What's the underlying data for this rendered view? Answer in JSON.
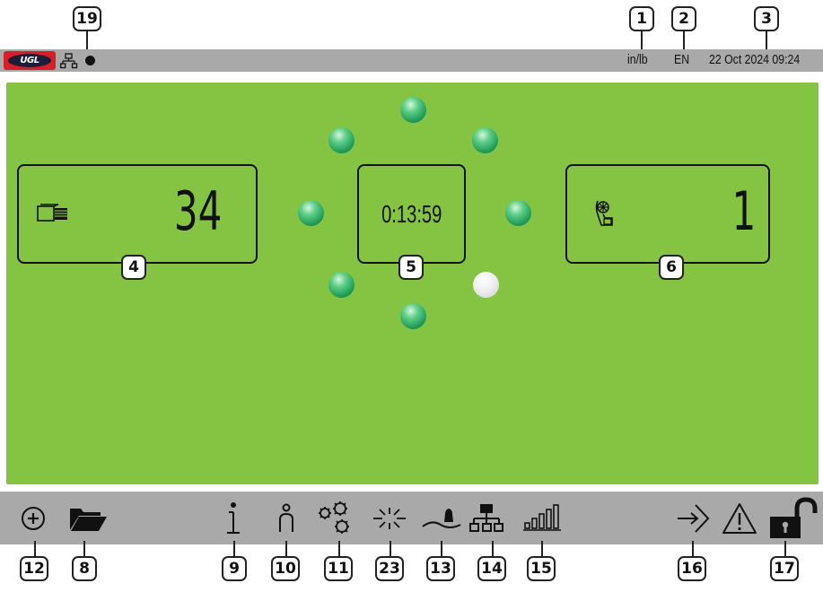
{
  "topbar": {
    "units": "in/lb",
    "language": "EN",
    "datetime": "22 Oct 2024 09:24"
  },
  "counters": {
    "parts_count": "34",
    "cycle_time": "0:13:59",
    "spindle_count": "1"
  },
  "leds": {
    "states": [
      "on",
      "on",
      "on",
      "on",
      "on",
      "off",
      "on",
      "on"
    ]
  },
  "callouts": {
    "c1": "1",
    "c2": "2",
    "c3": "3",
    "c4": "4",
    "c5": "5",
    "c6": "6",
    "c8": "8",
    "c9": "9",
    "c10": "10",
    "c11": "11",
    "c12": "12",
    "c13": "13",
    "c14": "14",
    "c15": "15",
    "c16": "16",
    "c17": "17",
    "c19": "19",
    "c23": "23"
  },
  "icons": {
    "topbar": [
      "network-icon",
      "status-dot"
    ],
    "toolbar": [
      "add-icon",
      "folder-icon",
      "info-icon",
      "operator-icon",
      "settings-icon",
      "light-icon",
      "level-icon",
      "network-icon",
      "signal-icon",
      "login-icon",
      "warning-icon",
      "unlock-icon"
    ]
  },
  "colors": {
    "bar": "#a9a9a9",
    "panel": "#85c443",
    "led_on": "#2ea862",
    "led_off": "#e6e6e6",
    "logo": "#d81f28"
  }
}
